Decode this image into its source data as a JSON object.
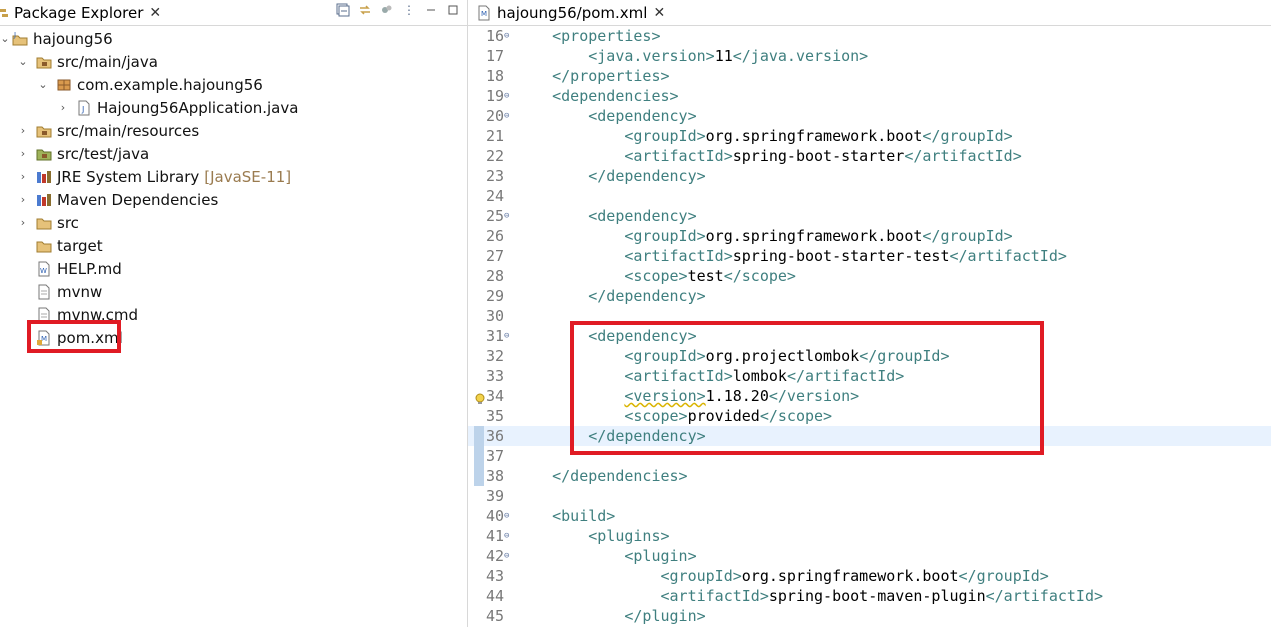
{
  "left_panel": {
    "tab_title": "Package Explorer",
    "tree": [
      {
        "label": "hajoung56",
        "icon": "project-icon"
      },
      {
        "label": "src/main/java",
        "icon": "source-folder-icon"
      },
      {
        "label": "com.example.hajoung56",
        "icon": "package-icon"
      },
      {
        "label": "Hajoung56Application.java",
        "icon": "java-file-icon"
      },
      {
        "label": "src/main/resources",
        "icon": "source-folder-icon"
      },
      {
        "label": "src/test/java",
        "icon": "source-folder-icon"
      },
      {
        "label": "JRE System Library",
        "decoration": "[JavaSE-11]",
        "icon": "library-icon"
      },
      {
        "label": "Maven Dependencies",
        "icon": "library-icon"
      },
      {
        "label": "src",
        "icon": "folder-icon"
      },
      {
        "label": "target",
        "icon": "folder-icon"
      },
      {
        "label": "HELP.md",
        "icon": "md-file-icon"
      },
      {
        "label": "mvnw",
        "icon": "file-icon"
      },
      {
        "label": "mvnw.cmd",
        "icon": "file-icon"
      },
      {
        "label": "pom.xml",
        "icon": "xml-file-icon"
      }
    ]
  },
  "editor": {
    "tab_title": "hajoung56/pom.xml",
    "lines": [
      {
        "num": "16",
        "text": "    <properties>"
      },
      {
        "num": "17",
        "text": "        <java.version>11</java.version>"
      },
      {
        "num": "18",
        "text": "    </properties>"
      },
      {
        "num": "19",
        "text": "    <dependencies>"
      },
      {
        "num": "20",
        "text": "        <dependency>"
      },
      {
        "num": "21",
        "text": "            <groupId>org.springframework.boot</groupId>"
      },
      {
        "num": "22",
        "text": "            <artifactId>spring-boot-starter</artifactId>"
      },
      {
        "num": "23",
        "text": "        </dependency>"
      },
      {
        "num": "24",
        "text": ""
      },
      {
        "num": "25",
        "text": "        <dependency>"
      },
      {
        "num": "26",
        "text": "            <groupId>org.springframework.boot</groupId>"
      },
      {
        "num": "27",
        "text": "            <artifactId>spring-boot-starter-test</artifactId>"
      },
      {
        "num": "28",
        "text": "            <scope>test</scope>"
      },
      {
        "num": "29",
        "text": "        </dependency>"
      },
      {
        "num": "30",
        "text": ""
      },
      {
        "num": "31",
        "text": "        <dependency>"
      },
      {
        "num": "32",
        "text": "            <groupId>org.projectlombok</groupId>"
      },
      {
        "num": "33",
        "text": "            <artifactId>lombok</artifactId>"
      },
      {
        "num": "34",
        "text": "            <version>1.18.20</version>"
      },
      {
        "num": "35",
        "text": "            <scope>provided</scope>"
      },
      {
        "num": "36",
        "text": "        </dependency>"
      },
      {
        "num": "37",
        "text": ""
      },
      {
        "num": "38",
        "text": "    </dependencies>"
      },
      {
        "num": "39",
        "text": ""
      },
      {
        "num": "40",
        "text": "    <build>"
      },
      {
        "num": "41",
        "text": "        <plugins>"
      },
      {
        "num": "42",
        "text": "            <plugin>"
      },
      {
        "num": "43",
        "text": "                <groupId>org.springframework.boot</groupId>"
      },
      {
        "num": "44",
        "text": "                <artifactId>spring-boot-maven-plugin</artifactId>"
      },
      {
        "num": "45",
        "text": "            </plugin>"
      }
    ]
  },
  "colors": {
    "highlight": "#e01b24",
    "tag": "#3f7f7f",
    "line_number": "#787878",
    "current_line": "#e8f2fe"
  }
}
